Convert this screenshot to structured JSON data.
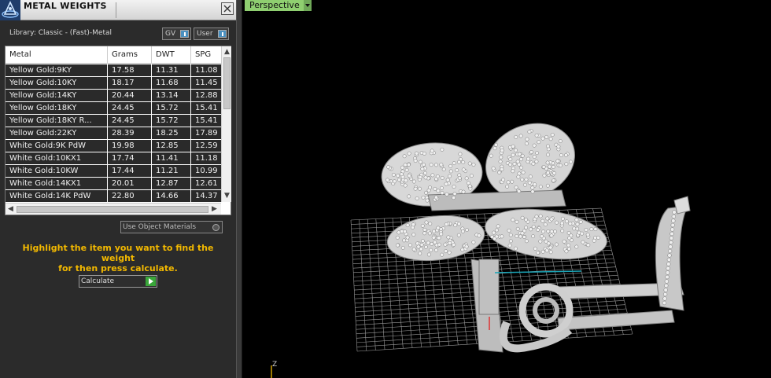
{
  "panel": {
    "title": "METAL WEIGHTS",
    "library_label": "Library: Classic - (Fast)-Metal",
    "gv_label": "GV",
    "user_label": "User",
    "use_object_materials": "Use Object Materials",
    "hint_line1": "Highlight the item you want to find the weight",
    "hint_line2": "for then press calculate.",
    "calculate_label": "Calculate"
  },
  "table": {
    "headers": [
      "Metal",
      "Grams",
      "DWT",
      "SPG"
    ],
    "rows": [
      [
        "Yellow Gold:9KY",
        "17.58",
        "11.31",
        "11.08"
      ],
      [
        "Yellow Gold:10KY",
        "18.17",
        "11.68",
        "11.45"
      ],
      [
        "Yellow Gold:14KY",
        "20.44",
        "13.14",
        "12.88"
      ],
      [
        "Yellow Gold:18KY",
        "24.45",
        "15.72",
        "15.41"
      ],
      [
        "Yellow Gold:18KY R...",
        "24.45",
        "15.72",
        "15.41"
      ],
      [
        "Yellow Gold:22KY",
        "28.39",
        "18.25",
        "17.89"
      ],
      [
        "White Gold:9K PdW",
        "19.98",
        "12.85",
        "12.59"
      ],
      [
        "White Gold:10KX1",
        "17.74",
        "11.41",
        "11.18"
      ],
      [
        "White Gold:10KW",
        "17.44",
        "11.21",
        "10.99"
      ],
      [
        "White Gold:14KX1",
        "20.01",
        "12.87",
        "12.61"
      ],
      [
        "White Gold:14K PdW",
        "22.80",
        "14.66",
        "14.37"
      ]
    ]
  },
  "viewport": {
    "view_name": "Perspective",
    "axis_label": "Z"
  },
  "colors": {
    "hint": "#f2b800",
    "tab": "#8fcf70",
    "grid": "#9a9a9a",
    "accent_blue": "#4a90c0"
  }
}
